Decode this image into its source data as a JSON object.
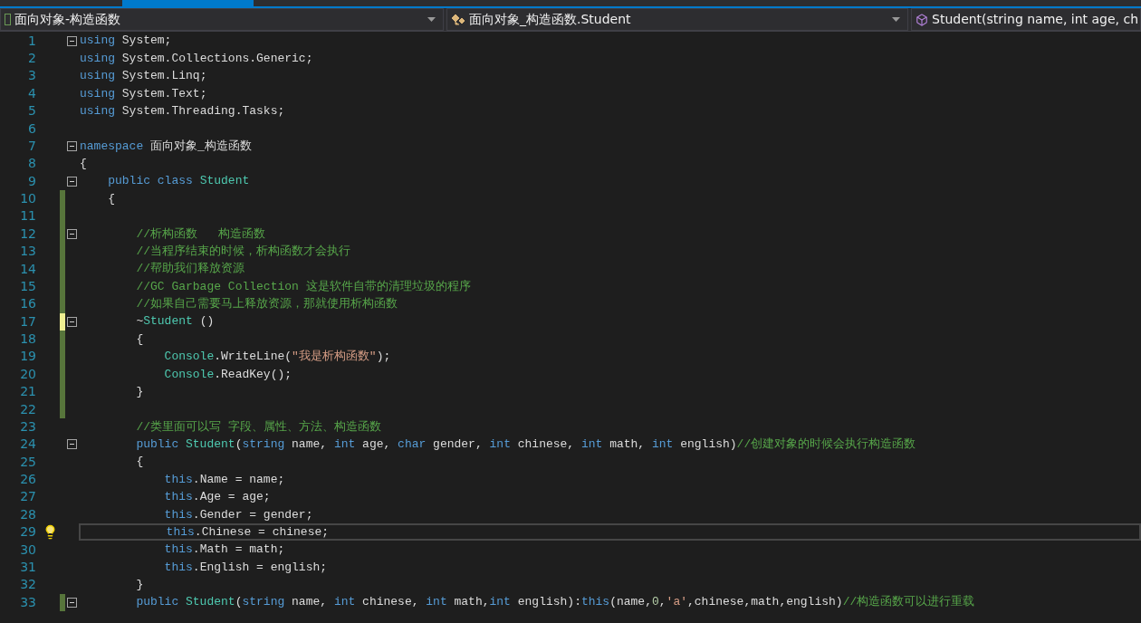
{
  "navigation_bar": [
    {
      "label": "面向对象-构造函数",
      "kind": "project"
    },
    {
      "label": "面向对象_构造函数.Student",
      "kind": "class"
    },
    {
      "label": "Student(string name, int age, ch",
      "kind": "method"
    }
  ],
  "lines": [
    {
      "number": "1",
      "fold": true,
      "tokens": [
        {
          "kind": "kw",
          "text": "using"
        },
        {
          "kind": "tx",
          "text": " System;"
        }
      ]
    },
    {
      "number": "2",
      "tokens": [
        {
          "kind": "kw",
          "text": "using"
        },
        {
          "kind": "tx",
          "text": " System.Collections.Generic;"
        }
      ]
    },
    {
      "number": "3",
      "tokens": [
        {
          "kind": "kw",
          "text": "using"
        },
        {
          "kind": "tx",
          "text": " System.Linq;"
        }
      ]
    },
    {
      "number": "4",
      "tokens": [
        {
          "kind": "kw",
          "text": "using"
        },
        {
          "kind": "tx",
          "text": " System.Text;"
        }
      ]
    },
    {
      "number": "5",
      "tokens": [
        {
          "kind": "kw",
          "text": "using"
        },
        {
          "kind": "tx",
          "text": " System.Threading.Tasks;"
        }
      ]
    },
    {
      "number": "6"
    },
    {
      "number": "7",
      "fold": true,
      "tokens": [
        {
          "kind": "kw",
          "text": "namespace"
        },
        {
          "kind": "tx",
          "text": " 面向对象_构造函数"
        }
      ]
    },
    {
      "number": "8",
      "tokens": [
        {
          "kind": "tx",
          "text": "{"
        }
      ]
    },
    {
      "number": "9",
      "fold": true,
      "tokens": [
        {
          "kind": "kw",
          "text": "    public class"
        },
        {
          "kind": "ty",
          "text": " Student"
        }
      ]
    },
    {
      "number": "10",
      "color": "#57753b",
      "tokens": [
        {
          "kind": "tx",
          "text": "    {"
        }
      ]
    },
    {
      "number": "11",
      "color": "#57753b"
    },
    {
      "number": "12",
      "color": "#57753b",
      "fold": true,
      "tokens": [
        {
          "kind": "cm",
          "text": "        //析构函数   构造函数"
        }
      ]
    },
    {
      "number": "13",
      "color": "#57753b",
      "tokens": [
        {
          "kind": "cm",
          "text": "        //当程序结束的时候，析构函数才会执行"
        }
      ]
    },
    {
      "number": "14",
      "color": "#57753b",
      "tokens": [
        {
          "kind": "cm",
          "text": "        //帮助我们释放资源"
        }
      ]
    },
    {
      "number": "15",
      "color": "#57753b",
      "tokens": [
        {
          "kind": "cm",
          "text": "        //GC Garbage Collection 这是软件自带的清理垃圾的程序"
        }
      ]
    },
    {
      "number": "16",
      "color": "#57753b",
      "tokens": [
        {
          "kind": "cm",
          "text": "        //如果自己需要马上释放资源，那就使用析构函数"
        }
      ]
    },
    {
      "number": "17",
      "color": "#efef91",
      "fold": true,
      "tokens": [
        {
          "kind": "tx",
          "text": "        ~"
        },
        {
          "kind": "ty",
          "text": "Student"
        },
        {
          "kind": "tx",
          "text": " ()"
        }
      ]
    },
    {
      "number": "18",
      "color": "#57753b",
      "tokens": [
        {
          "kind": "tx",
          "text": "        {"
        }
      ]
    },
    {
      "number": "19",
      "color": "#57753b",
      "tokens": [
        {
          "kind": "ty",
          "text": "            Console"
        },
        {
          "kind": "tx",
          "text": ".WriteLine("
        },
        {
          "kind": "st",
          "text": "\"我是析构函数\""
        },
        {
          "kind": "tx",
          "text": ");"
        }
      ]
    },
    {
      "number": "20",
      "color": "#57753b",
      "tokens": [
        {
          "kind": "ty",
          "text": "            Console"
        },
        {
          "kind": "tx",
          "text": ".ReadKey();"
        }
      ]
    },
    {
      "number": "21",
      "color": "#57753b",
      "tokens": [
        {
          "kind": "tx",
          "text": "        }"
        }
      ]
    },
    {
      "number": "22",
      "color": "#57753b"
    },
    {
      "number": "23",
      "tokens": [
        {
          "kind": "cm",
          "text": "        //类里面可以写 字段、属性、方法、构造函数"
        }
      ]
    },
    {
      "number": "24",
      "fold": true,
      "tokens": [
        {
          "kind": "kw",
          "text": "        public"
        },
        {
          "kind": "ty",
          "text": " Student"
        },
        {
          "kind": "tx",
          "text": "("
        },
        {
          "kind": "kw",
          "text": "string"
        },
        {
          "kind": "tx",
          "text": " name, "
        },
        {
          "kind": "kw",
          "text": "int"
        },
        {
          "kind": "tx",
          "text": " age, "
        },
        {
          "kind": "kw",
          "text": "char"
        },
        {
          "kind": "tx",
          "text": " gender, "
        },
        {
          "kind": "kw",
          "text": "int"
        },
        {
          "kind": "tx",
          "text": " chinese, "
        },
        {
          "kind": "kw",
          "text": "int"
        },
        {
          "kind": "tx",
          "text": " math, "
        },
        {
          "kind": "kw",
          "text": "int"
        },
        {
          "kind": "tx",
          "text": " english)"
        },
        {
          "kind": "cm",
          "text": "//创建对象的时候会执行构造函数"
        }
      ]
    },
    {
      "number": "25",
      "tokens": [
        {
          "kind": "tx",
          "text": "        {"
        }
      ]
    },
    {
      "number": "26",
      "tokens": [
        {
          "kind": "kw",
          "text": "            this"
        },
        {
          "kind": "tx",
          "text": ".Name = name;"
        }
      ]
    },
    {
      "number": "27",
      "tokens": [
        {
          "kind": "kw",
          "text": "            this"
        },
        {
          "kind": "tx",
          "text": ".Age = age;"
        }
      ]
    },
    {
      "number": "28",
      "tokens": [
        {
          "kind": "kw",
          "text": "            this"
        },
        {
          "kind": "tx",
          "text": ".Gender = gender;"
        }
      ]
    },
    {
      "number": "29",
      "current": true,
      "lightbulb": true,
      "tokens": [
        {
          "kind": "kw",
          "text": "            this"
        },
        {
          "kind": "tx",
          "text": ".Chinese = chinese;"
        }
      ]
    },
    {
      "number": "30",
      "tokens": [
        {
          "kind": "kw",
          "text": "            this"
        },
        {
          "kind": "tx",
          "text": ".Math = math;"
        }
      ]
    },
    {
      "number": "31",
      "tokens": [
        {
          "kind": "kw",
          "text": "            this"
        },
        {
          "kind": "tx",
          "text": ".English = english;"
        }
      ]
    },
    {
      "number": "32",
      "tokens": [
        {
          "kind": "tx",
          "text": "        }"
        }
      ]
    },
    {
      "number": "33",
      "color": "#57753b",
      "fold": true,
      "tokens": [
        {
          "kind": "kw",
          "text": "        public"
        },
        {
          "kind": "ty",
          "text": " Student"
        },
        {
          "kind": "tx",
          "text": "("
        },
        {
          "kind": "kw",
          "text": "string"
        },
        {
          "kind": "tx",
          "text": " name, "
        },
        {
          "kind": "kw",
          "text": "int"
        },
        {
          "kind": "tx",
          "text": " chinese, "
        },
        {
          "kind": "kw",
          "text": "int"
        },
        {
          "kind": "tx",
          "text": " math,"
        },
        {
          "kind": "kw",
          "text": "int"
        },
        {
          "kind": "tx",
          "text": " english):"
        },
        {
          "kind": "kw",
          "text": "this"
        },
        {
          "kind": "tx",
          "text": "(name,"
        },
        {
          "kind": "nm",
          "text": "0"
        },
        {
          "kind": "tx",
          "text": ","
        },
        {
          "kind": "st",
          "text": "'a'"
        },
        {
          "kind": "tx",
          "text": ",chinese,math,english)"
        },
        {
          "kind": "cm",
          "text": "//构造函数可以进行重载"
        }
      ]
    }
  ]
}
